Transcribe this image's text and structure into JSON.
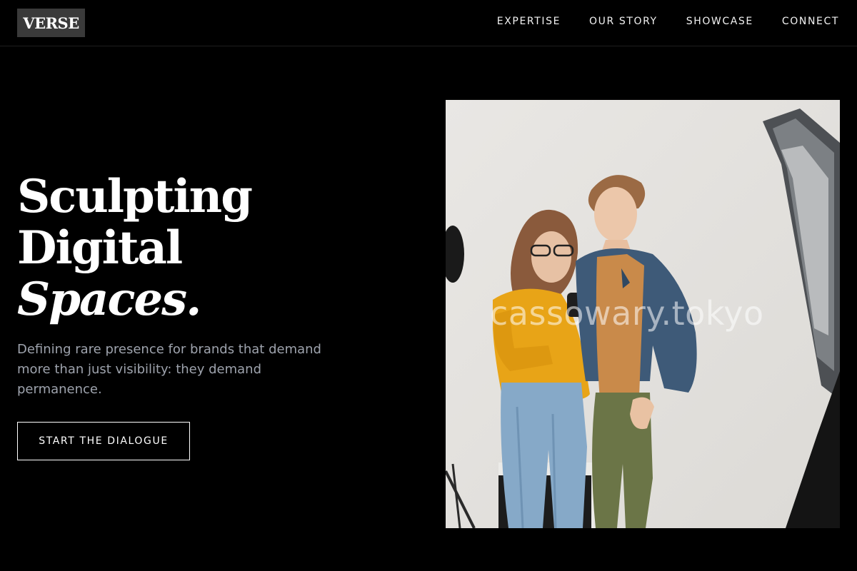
{
  "header": {
    "logo": "VERSE",
    "nav": [
      "EXPERTISE",
      "OUR STORY",
      "SHOWCASE",
      "CONNECT"
    ]
  },
  "hero": {
    "headline_line1": "Sculpting",
    "headline_line2": "Digital",
    "headline_line3": "Spaces.",
    "subtext": "Defining rare presence for brands that demand more than just visibility: they demand permanence.",
    "cta_label": "START THE DIALOGUE",
    "image_watermark": "cassowary.tokyo"
  },
  "colors": {
    "background": "#000000",
    "text": "#ffffff",
    "subtext": "#9ea3ad",
    "logo_bg": "#3a3a3a"
  }
}
